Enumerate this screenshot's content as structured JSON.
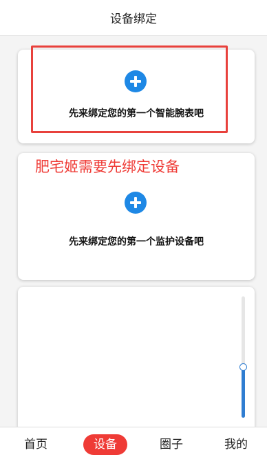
{
  "header": {
    "title": "设备绑定"
  },
  "cards": [
    {
      "label": "先来绑定您的第一个智能腕表吧"
    },
    {
      "label": "先来绑定您的第一个监护设备吧"
    }
  ],
  "annotation": {
    "text": "肥宅姬需要先绑定设备"
  },
  "scroll_slider": {
    "value_percent": 42
  },
  "tabbar": {
    "items": [
      {
        "label": "首页"
      },
      {
        "label": "设备",
        "active": true
      },
      {
        "label": "圈子"
      },
      {
        "label": "我的"
      }
    ]
  },
  "colors": {
    "accent_blue": "#1e88e5",
    "annotation_red": "#e8413c",
    "active_tab_red": "#ef3b36"
  },
  "icons": [
    "add-circle-icon"
  ]
}
